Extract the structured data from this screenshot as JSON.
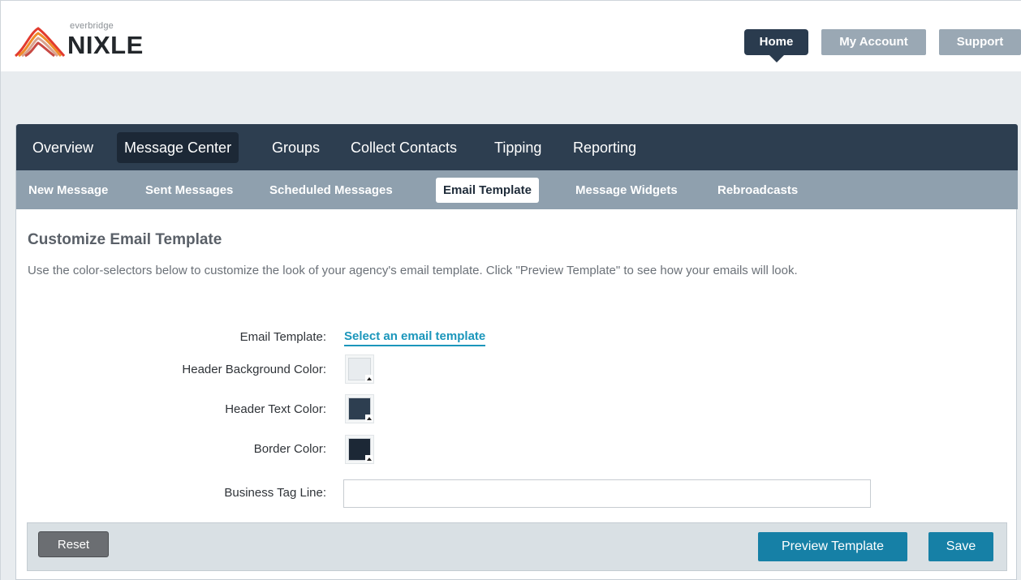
{
  "brand": {
    "sub": "everbridge",
    "name": "NIXLE",
    "icon": "nixle-logo-waves"
  },
  "top_nav": {
    "home": "Home",
    "my_account": "My Account",
    "support": "Support"
  },
  "primary_nav": [
    {
      "label": "Overview",
      "active": false
    },
    {
      "label": "Message Center",
      "active": true
    },
    {
      "label": "Groups",
      "active": false
    },
    {
      "label": "Collect Contacts",
      "active": false
    },
    {
      "label": "Tipping",
      "active": false
    },
    {
      "label": "Reporting",
      "active": false
    }
  ],
  "secondary_nav": [
    {
      "label": "New Message",
      "active": false
    },
    {
      "label": "Sent Messages",
      "active": false
    },
    {
      "label": "Scheduled Messages",
      "active": false
    },
    {
      "label": "Email Template",
      "active": true
    },
    {
      "label": "Message Widgets",
      "active": false
    },
    {
      "label": "Rebroadcasts",
      "active": false
    }
  ],
  "content": {
    "title": "Customize Email Template",
    "description": "Use the color-selectors below to customize the look of your agency's email template. Click \"Preview Template\" to see how your emails will look."
  },
  "form": {
    "email_template_label": "Email Template:",
    "email_template_link": "Select an email template",
    "header_bg_label": "Header Background Color:",
    "header_bg_color": "#e8ecef",
    "header_text_label": "Header Text Color:",
    "header_text_color": "#2d3e50",
    "border_label": "Border Color:",
    "border_color": "#1c2836",
    "tagline_label": "Business Tag Line:",
    "tagline_value": ""
  },
  "actions": {
    "reset": "Reset",
    "preview": "Preview Template",
    "save": "Save"
  }
}
